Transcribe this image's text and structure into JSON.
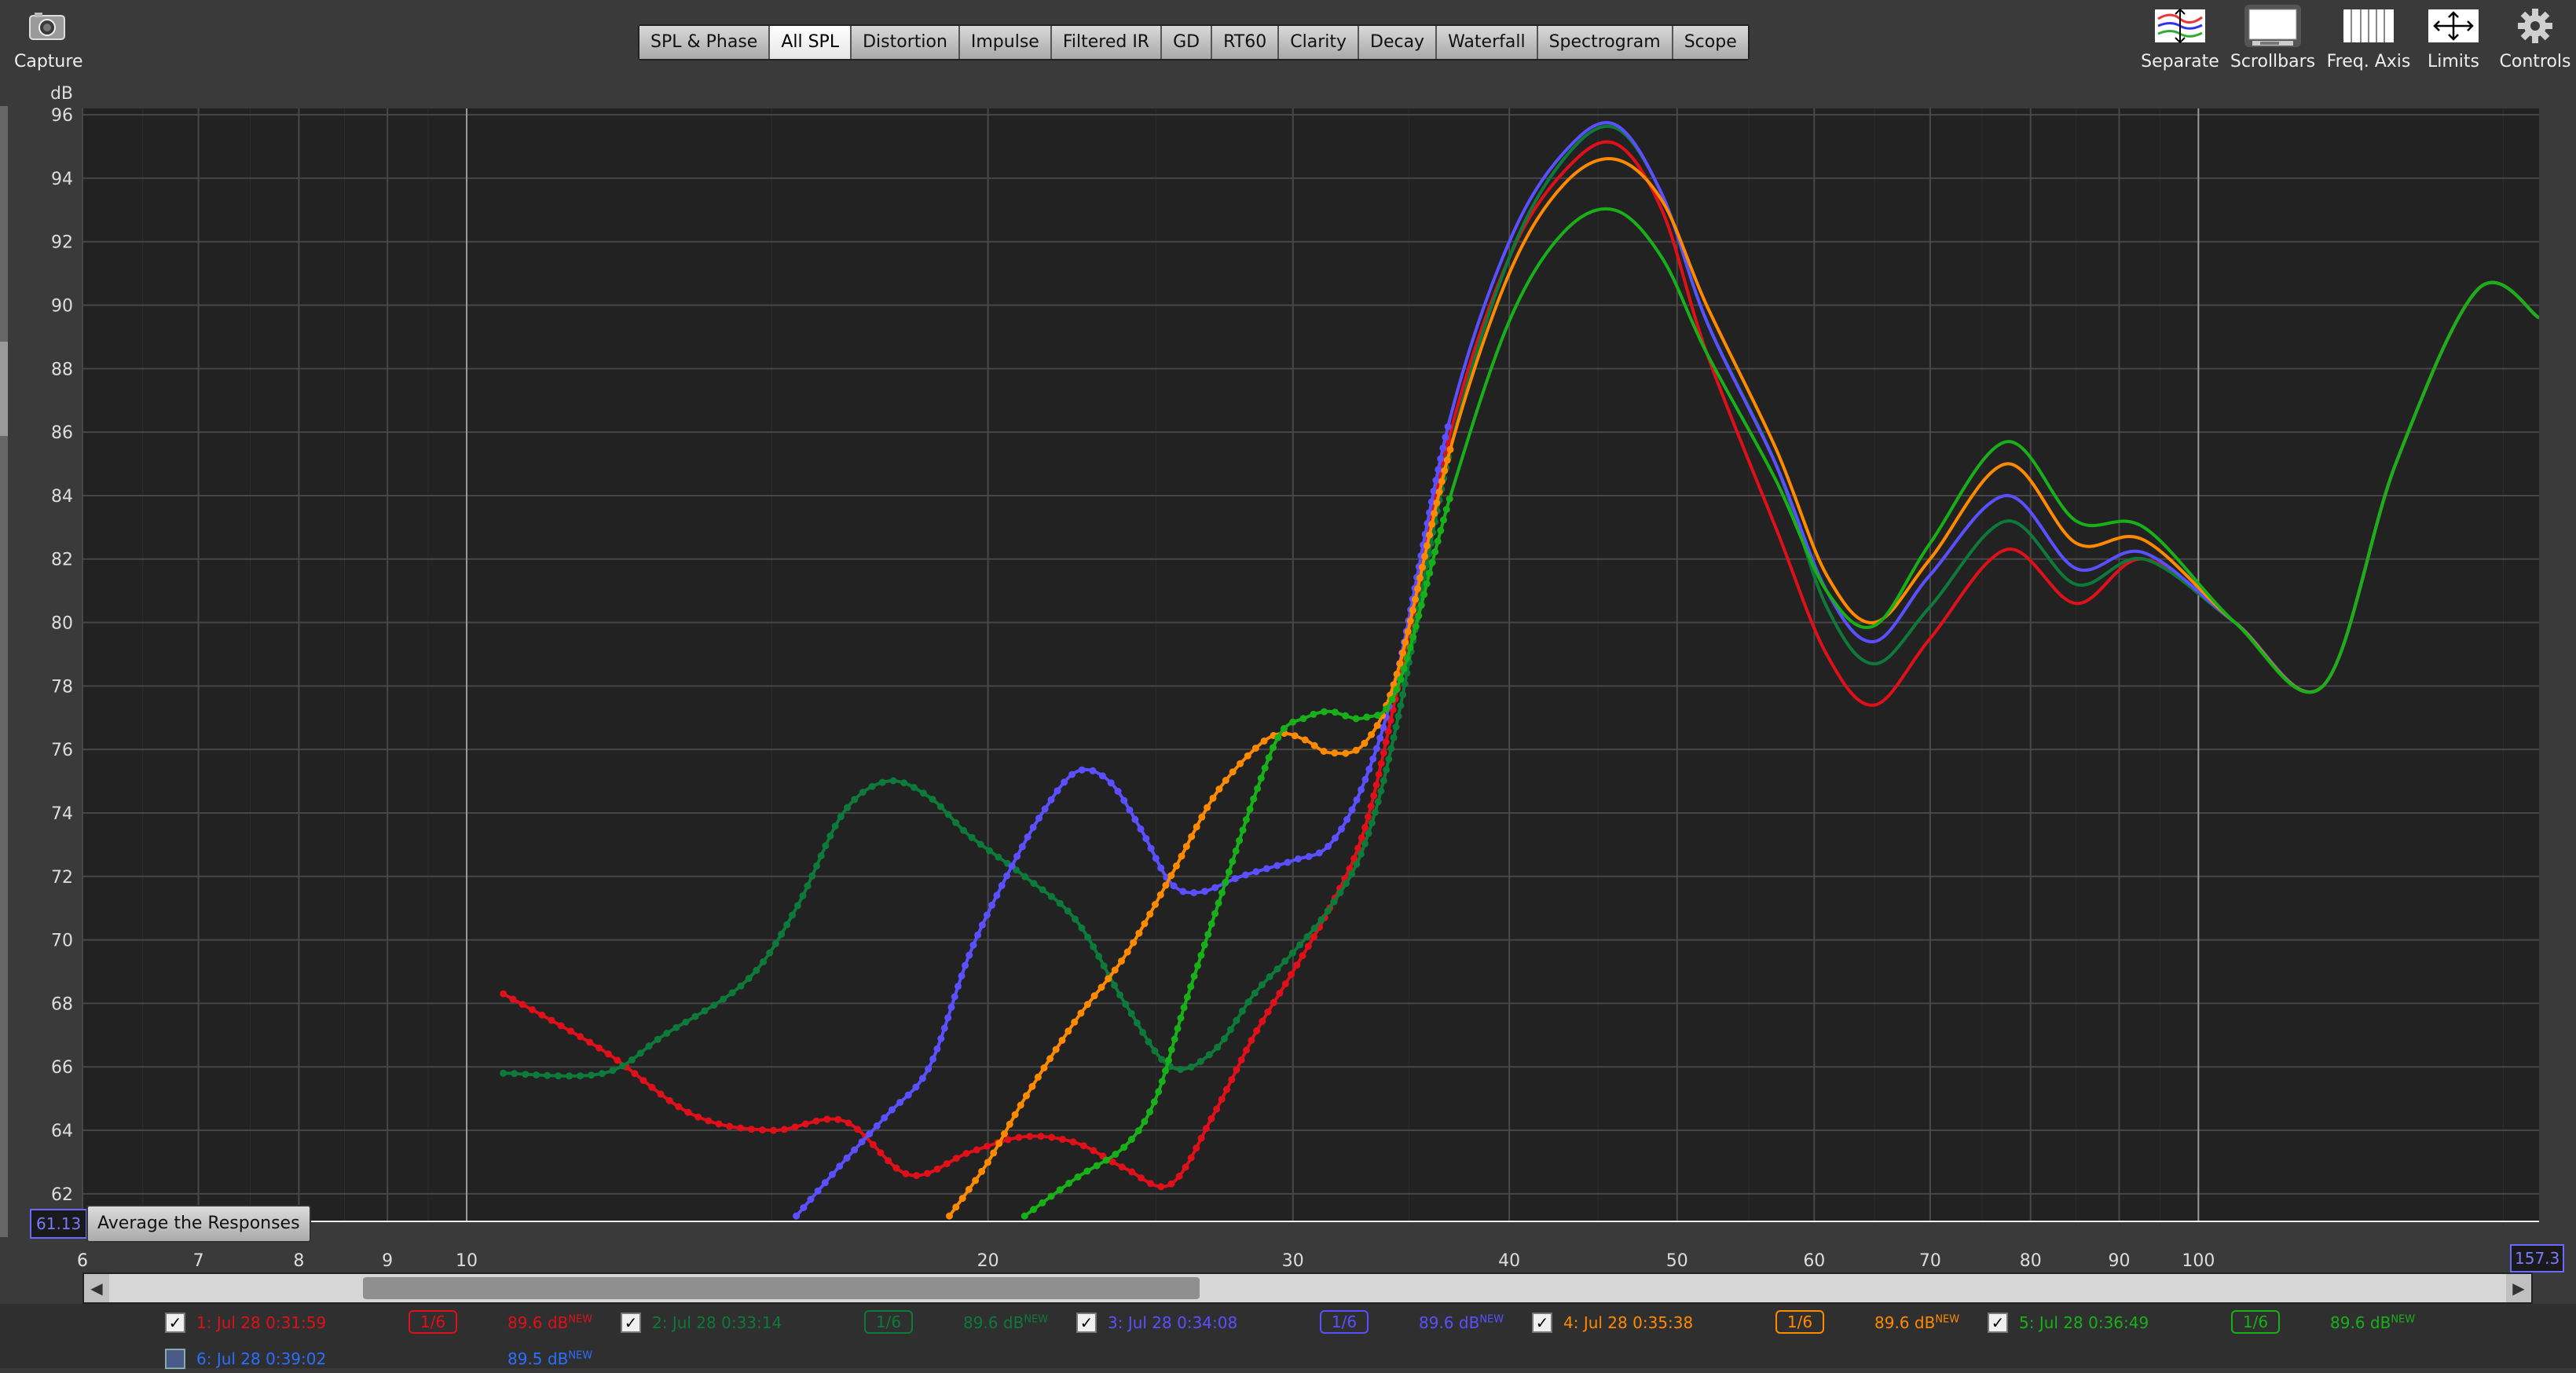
{
  "toolbar": {
    "capture_label": "Capture",
    "right_tools": [
      {
        "label": "Separate",
        "icon": "separate-icon"
      },
      {
        "label": "Scrollbars",
        "icon": "scrollbars-icon"
      },
      {
        "label": "Freq. Axis",
        "icon": "freq-axis-icon"
      },
      {
        "label": "Limits",
        "icon": "limits-icon"
      },
      {
        "label": "Controls",
        "icon": "gear-icon"
      }
    ]
  },
  "tabs": [
    "SPL & Phase",
    "All SPL",
    "Distortion",
    "Impulse",
    "Filtered IR",
    "GD",
    "RT60",
    "Clarity",
    "Decay",
    "Waterfall",
    "Spectrogram",
    "Scope"
  ],
  "active_tab": "All SPL",
  "plot_controls": {
    "avg_value": "61.13",
    "avg_button": "Average the Responses",
    "x_max_value": "157.3"
  },
  "legend": [
    {
      "checked": true,
      "label": "1: Jul 28 0:31:59",
      "smoothing": "1/6",
      "level": "89.6 dB",
      "badge": "NEW",
      "color": "#e0101a"
    },
    {
      "checked": true,
      "label": "2: Jul 28 0:33:14",
      "smoothing": "1/6",
      "level": "89.6 dB",
      "badge": "NEW",
      "color": "#0d7a3a"
    },
    {
      "checked": true,
      "label": "3: Jul 28 0:34:08",
      "smoothing": "1/6",
      "level": "89.6 dB",
      "badge": "NEW",
      "color": "#5a50ff"
    },
    {
      "checked": true,
      "label": "4: Jul 28 0:35:38",
      "smoothing": "1/6",
      "level": "89.6 dB",
      "badge": "NEW",
      "color": "#ff8a00"
    },
    {
      "checked": true,
      "label": "5: Jul 28 0:36:49",
      "smoothing": "1/6",
      "level": "89.6 dB",
      "badge": "NEW",
      "color": "#18b018"
    },
    {
      "checked": false,
      "label": "6: Jul 28 0:39:02",
      "smoothing": "",
      "level": "89.5 dB",
      "badge": "NEW",
      "color": "#2a6fff"
    }
  ],
  "chart_data": {
    "type": "line",
    "ylabel": "dB",
    "xlabel": "",
    "xscale": "log",
    "xlim": [
      6,
      157.3
    ],
    "ylim": [
      61.13,
      96.2
    ],
    "grid": true,
    "y_ticks": [
      62,
      64,
      66,
      68,
      70,
      72,
      74,
      76,
      78,
      80,
      82,
      84,
      86,
      88,
      90,
      92,
      94,
      96
    ],
    "x_ticks": [
      6,
      7,
      8,
      9,
      10,
      20,
      30,
      40,
      50,
      60,
      70,
      80,
      90,
      100
    ],
    "x_tick_labels": [
      "6",
      "7",
      "8",
      "9",
      "10",
      "20",
      "30",
      "40",
      "50",
      "60",
      "70",
      "80",
      "90",
      "100"
    ],
    "series": [
      {
        "name": "1: Jul 28 0:31:59",
        "color": "#e0101a",
        "points": [
          [
            10.5,
            68.3
          ],
          [
            12.0,
            66.5
          ],
          [
            13.5,
            64.5
          ],
          [
            15.0,
            64.0
          ],
          [
            16.5,
            64.3
          ],
          [
            18.0,
            62.6
          ],
          [
            19.5,
            63.3
          ],
          [
            21.0,
            63.8
          ],
          [
            22.5,
            63.6
          ],
          [
            24.0,
            62.8
          ],
          [
            25.5,
            62.3
          ],
          [
            27.0,
            64.5
          ],
          [
            28.5,
            67.0
          ],
          [
            30.0,
            69.0
          ],
          [
            31.5,
            71.0
          ],
          [
            33.0,
            73.5
          ],
          [
            34.5,
            78.0
          ],
          [
            37.0,
            86.0
          ],
          [
            40.0,
            91.5
          ],
          [
            43.0,
            94.2
          ],
          [
            46.0,
            95.1
          ],
          [
            49.0,
            93.0
          ],
          [
            52.0,
            88.5
          ],
          [
            57.0,
            83.0
          ],
          [
            61.0,
            79.0
          ],
          [
            65.0,
            77.4
          ],
          [
            70.0,
            79.5
          ],
          [
            77.5,
            82.3
          ],
          [
            85.0,
            80.6
          ],
          [
            93.0,
            82.0
          ],
          [
            105.0,
            80.0
          ],
          [
            118.0,
            78.0
          ],
          [
            130.0,
            85.0
          ],
          [
            145.0,
            90.5
          ],
          [
            157.3,
            89.6
          ]
        ]
      },
      {
        "name": "2: Jul 28 0:33:14",
        "color": "#0d7a3a",
        "points": [
          [
            10.5,
            65.8
          ],
          [
            12.0,
            65.8
          ],
          [
            13.0,
            67.0
          ],
          [
            14.5,
            68.7
          ],
          [
            15.5,
            71.0
          ],
          [
            16.5,
            74.0
          ],
          [
            17.5,
            75.0
          ],
          [
            18.5,
            74.5
          ],
          [
            19.5,
            73.3
          ],
          [
            21.0,
            72.0
          ],
          [
            22.5,
            70.6
          ],
          [
            24.0,
            68.0
          ],
          [
            25.5,
            66.0
          ],
          [
            27.0,
            66.5
          ],
          [
            28.5,
            68.3
          ],
          [
            30.0,
            69.6
          ],
          [
            31.5,
            71.0
          ],
          [
            33.0,
            73.0
          ],
          [
            34.5,
            77.0
          ],
          [
            37.0,
            85.5
          ],
          [
            40.0,
            91.5
          ],
          [
            43.0,
            94.6
          ],
          [
            46.0,
            95.6
          ],
          [
            49.0,
            93.5
          ],
          [
            52.0,
            89.5
          ],
          [
            57.0,
            85.0
          ],
          [
            61.0,
            80.5
          ],
          [
            65.0,
            78.7
          ],
          [
            70.0,
            80.5
          ],
          [
            77.5,
            83.2
          ],
          [
            85.0,
            81.2
          ],
          [
            93.0,
            82.0
          ],
          [
            105.0,
            80.0
          ],
          [
            118.0,
            78.0
          ],
          [
            130.0,
            85.0
          ],
          [
            145.0,
            90.5
          ],
          [
            157.3,
            89.6
          ]
        ]
      },
      {
        "name": "3: Jul 28 0:34:08",
        "color": "#5a50ff",
        "points": [
          [
            15.5,
            61.3
          ],
          [
            16.5,
            63.0
          ],
          [
            17.5,
            64.5
          ],
          [
            18.5,
            66.0
          ],
          [
            19.5,
            69.5
          ],
          [
            20.5,
            72.0
          ],
          [
            21.5,
            74.0
          ],
          [
            22.5,
            75.3
          ],
          [
            23.5,
            75.0
          ],
          [
            24.5,
            73.5
          ],
          [
            25.5,
            71.8
          ],
          [
            26.5,
            71.5
          ],
          [
            28.0,
            72.0
          ],
          [
            30.0,
            72.5
          ],
          [
            31.5,
            73.0
          ],
          [
            33.0,
            75.0
          ],
          [
            34.5,
            78.5
          ],
          [
            37.0,
            86.5
          ],
          [
            40.0,
            92.0
          ],
          [
            43.0,
            94.8
          ],
          [
            46.0,
            95.7
          ],
          [
            49.0,
            93.5
          ],
          [
            52.0,
            89.5
          ],
          [
            57.0,
            85.0
          ],
          [
            61.0,
            81.0
          ],
          [
            65.0,
            79.4
          ],
          [
            70.0,
            81.5
          ],
          [
            77.5,
            84.0
          ],
          [
            85.0,
            81.7
          ],
          [
            93.0,
            82.2
          ],
          [
            105.0,
            80.0
          ],
          [
            118.0,
            78.0
          ],
          [
            130.0,
            85.0
          ],
          [
            145.0,
            90.5
          ],
          [
            157.3,
            89.6
          ]
        ]
      },
      {
        "name": "4: Jul 28 0:35:38",
        "color": "#ff8a00",
        "points": [
          [
            19.0,
            61.3
          ],
          [
            20.0,
            63.0
          ],
          [
            21.0,
            65.0
          ],
          [
            22.5,
            67.5
          ],
          [
            24.0,
            69.5
          ],
          [
            25.5,
            72.0
          ],
          [
            27.0,
            74.5
          ],
          [
            28.5,
            76.0
          ],
          [
            29.5,
            76.5
          ],
          [
            30.5,
            76.3
          ],
          [
            31.5,
            75.9
          ],
          [
            33.0,
            76.2
          ],
          [
            34.5,
            78.5
          ],
          [
            37.0,
            85.5
          ],
          [
            40.0,
            91.0
          ],
          [
            43.0,
            93.8
          ],
          [
            46.0,
            94.6
          ],
          [
            49.0,
            93.3
          ],
          [
            52.0,
            90.0
          ],
          [
            57.0,
            85.5
          ],
          [
            61.0,
            81.5
          ],
          [
            65.0,
            80.0
          ],
          [
            70.0,
            82.0
          ],
          [
            77.5,
            85.0
          ],
          [
            85.0,
            82.5
          ],
          [
            93.0,
            82.6
          ],
          [
            105.0,
            80.0
          ],
          [
            118.0,
            78.0
          ],
          [
            130.0,
            85.0
          ],
          [
            145.0,
            90.5
          ],
          [
            157.3,
            89.6
          ]
        ]
      },
      {
        "name": "5: Jul 28 0:36:49",
        "color": "#18b018",
        "points": [
          [
            21.0,
            61.3
          ],
          [
            22.5,
            62.5
          ],
          [
            24.0,
            63.5
          ],
          [
            25.0,
            65.0
          ],
          [
            26.0,
            68.0
          ],
          [
            27.5,
            72.0
          ],
          [
            28.5,
            74.5
          ],
          [
            29.5,
            76.5
          ],
          [
            30.5,
            77.0
          ],
          [
            31.5,
            77.2
          ],
          [
            33.0,
            77.0
          ],
          [
            34.5,
            78.0
          ],
          [
            37.0,
            84.0
          ],
          [
            40.0,
            89.5
          ],
          [
            43.0,
            92.3
          ],
          [
            46.0,
            93.0
          ],
          [
            49.0,
            91.5
          ],
          [
            52.0,
            88.5
          ],
          [
            57.0,
            84.5
          ],
          [
            61.0,
            81.0
          ],
          [
            65.0,
            79.9
          ],
          [
            70.0,
            82.5
          ],
          [
            77.5,
            85.7
          ],
          [
            85.0,
            83.2
          ],
          [
            93.0,
            83.0
          ],
          [
            105.0,
            80.0
          ],
          [
            118.0,
            78.0
          ],
          [
            130.0,
            85.0
          ],
          [
            145.0,
            90.5
          ],
          [
            157.3,
            89.6
          ]
        ]
      }
    ]
  }
}
